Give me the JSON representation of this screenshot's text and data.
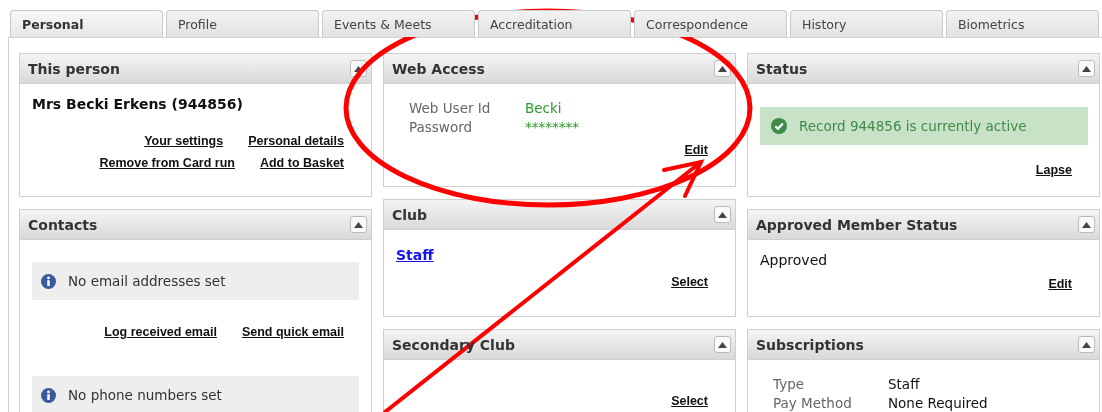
{
  "tabs": [
    {
      "label": "Personal",
      "selected": true
    },
    {
      "label": "Profile",
      "selected": false
    },
    {
      "label": "Events & Meets",
      "selected": false
    },
    {
      "label": "Accreditation",
      "selected": false
    },
    {
      "label": "Correspondence",
      "selected": false
    },
    {
      "label": "History",
      "selected": false
    },
    {
      "label": "Biometrics",
      "selected": false
    }
  ],
  "columns": [
    [
      {
        "title": "This person",
        "blocks": [
          {
            "kind": "heading",
            "text": "Mrs Becki Erkens (944856)"
          },
          {
            "kind": "links",
            "items": [
              "Your settings",
              "Personal details"
            ]
          },
          {
            "kind": "links",
            "items": [
              "Remove from Card run",
              "Add to Basket"
            ]
          }
        ]
      },
      {
        "title": "Contacts",
        "blocks": [
          {
            "kind": "info",
            "text": "No email addresses set"
          },
          {
            "kind": "links",
            "items": [
              "Log received email",
              "Send quick email"
            ]
          },
          {
            "kind": "info",
            "text": "No phone numbers set"
          }
        ]
      }
    ],
    [
      {
        "title": "Web Access",
        "blocks": [
          {
            "kind": "credentials",
            "rows": [
              {
                "label": "Web User Id",
                "value": "Becki"
              },
              {
                "label": "Password",
                "value": "********"
              }
            ]
          },
          {
            "kind": "links",
            "items": [
              "Edit"
            ]
          }
        ]
      },
      {
        "title": "Club",
        "blocks": [
          {
            "kind": "club",
            "text": "Staff"
          },
          {
            "kind": "links",
            "items": [
              "Select"
            ]
          }
        ]
      },
      {
        "title": "Secondary Club",
        "blocks": [
          {
            "kind": "links",
            "items": [
              "Select"
            ]
          }
        ]
      }
    ],
    [
      {
        "title": "Status",
        "blocks": [
          {
            "kind": "success",
            "text": "Record 944856 is currently active"
          },
          {
            "kind": "links",
            "items": [
              "Lapse"
            ]
          }
        ]
      },
      {
        "title": "Approved Member Status",
        "blocks": [
          {
            "kind": "text",
            "text": "Approved"
          },
          {
            "kind": "links",
            "items": [
              "Edit"
            ]
          }
        ]
      },
      {
        "title": "Subscriptions",
        "blocks": [
          {
            "kind": "fields",
            "rows": [
              {
                "label": "Type",
                "value": "Staff"
              },
              {
                "label": "Pay Method",
                "value": "None Required"
              }
            ]
          }
        ]
      }
    ]
  ]
}
